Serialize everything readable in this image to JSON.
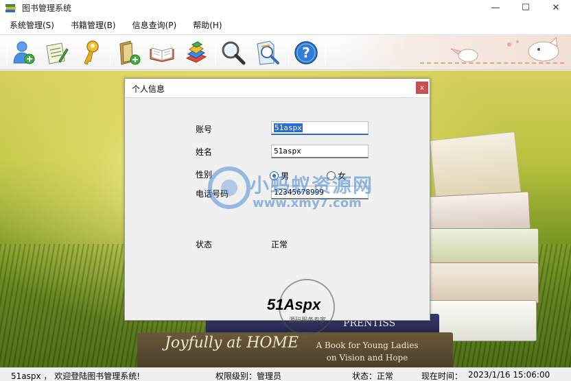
{
  "window": {
    "title": "图书管理系统",
    "minimize_glyph": "—",
    "maximize_glyph": "☐",
    "close_glyph": "✕"
  },
  "menu": [
    {
      "label": "系统管理(S)"
    },
    {
      "label": "书籍管理(B)"
    },
    {
      "label": "信息查询(P)"
    },
    {
      "label": "帮助(H)"
    }
  ],
  "toolbar": {
    "buttons": [
      {
        "icon": "user-add-icon"
      },
      {
        "icon": "edit-note-icon"
      },
      {
        "icon": "key-icon"
      },
      {
        "icon": "book-add-icon"
      },
      {
        "icon": "open-book-icon"
      },
      {
        "icon": "book-stack-icon"
      },
      {
        "icon": "magnifier-icon"
      },
      {
        "icon": "document-search-icon"
      },
      {
        "icon": "help-icon"
      }
    ]
  },
  "dialog": {
    "title": "个人信息",
    "close_glyph": "x",
    "fields": {
      "account_label": "账号",
      "account_value": "51aspx",
      "name_label": "姓名",
      "name_value": "51aspx",
      "gender_label": "性别",
      "gender_male": "男",
      "gender_female": "女",
      "gender_selected": "男",
      "phone_label": "电话号码",
      "phone_value": "12345678999",
      "status_label": "状态",
      "status_value": "正常"
    }
  },
  "watermark": {
    "line1": "小蚂蚁资源网",
    "line2": "www.xmy7.com",
    "logo": "51Aspx",
    "logo_sub": "源码服务专家"
  },
  "background_text": {
    "book1": "PRENTISS",
    "book2": "A Book for Young Ladies on Vision and Hope",
    "book3": "Joyfully at HOME"
  },
  "statusbar": {
    "welcome": "51aspx ， 欢迎登陆图书管理系统!",
    "permission": "权限级别：管理员",
    "status": "状态：正常",
    "time_label": "现在时间：",
    "time_value": "2023/1/16 15:06:00"
  },
  "colors": {
    "accent": "#2a6bc7",
    "close_red": "#c75050",
    "watermark": "#3c82d2"
  }
}
